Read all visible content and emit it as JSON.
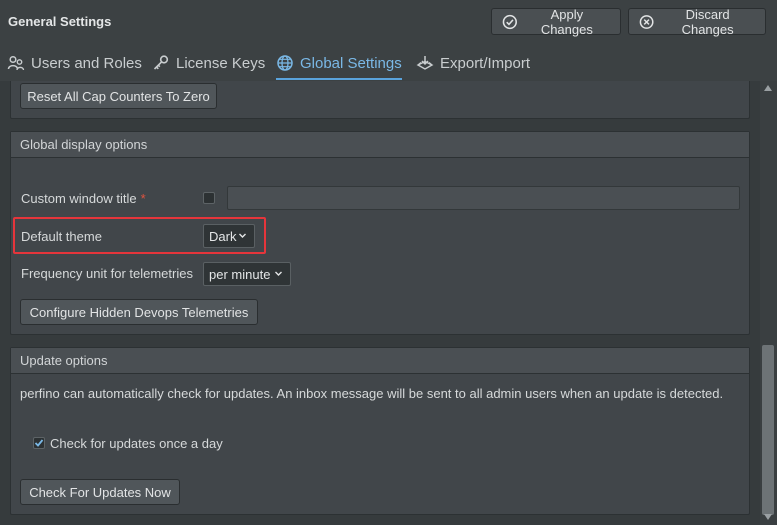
{
  "header": {
    "title": "General Settings",
    "apply_label": "Apply Changes",
    "discard_label": "Discard Changes"
  },
  "tabs": [
    {
      "label": "Users and Roles",
      "icon": "users-icon"
    },
    {
      "label": "License Keys",
      "icon": "key-icon"
    },
    {
      "label": "Global Settings",
      "icon": "globe-icon",
      "active": true
    },
    {
      "label": "Export/Import",
      "icon": "export-import-icon"
    }
  ],
  "cap_panel": {
    "reset_label": "Reset All Cap Counters To Zero"
  },
  "display_panel": {
    "header": "Global display options",
    "window_title_label": "Custom window title",
    "required_mark": "*",
    "window_title_value": "",
    "theme_label": "Default theme",
    "theme_value": "Dark",
    "frequency_label": "Frequency unit for telemetries",
    "frequency_value": "per minute",
    "configure_label": "Configure Hidden Devops Telemetries"
  },
  "update_panel": {
    "header": "Update options",
    "description": "perfino can automatically check for updates. An inbox message will be sent to all admin users when an update is detected.",
    "check_daily_label": "Check for updates once a day",
    "check_daily_checked": true,
    "check_now_label": "Check For Updates Now"
  },
  "colors": {
    "accent": "#5aa3dc",
    "highlight_border": "#e5353b",
    "required": "#e0533f"
  }
}
